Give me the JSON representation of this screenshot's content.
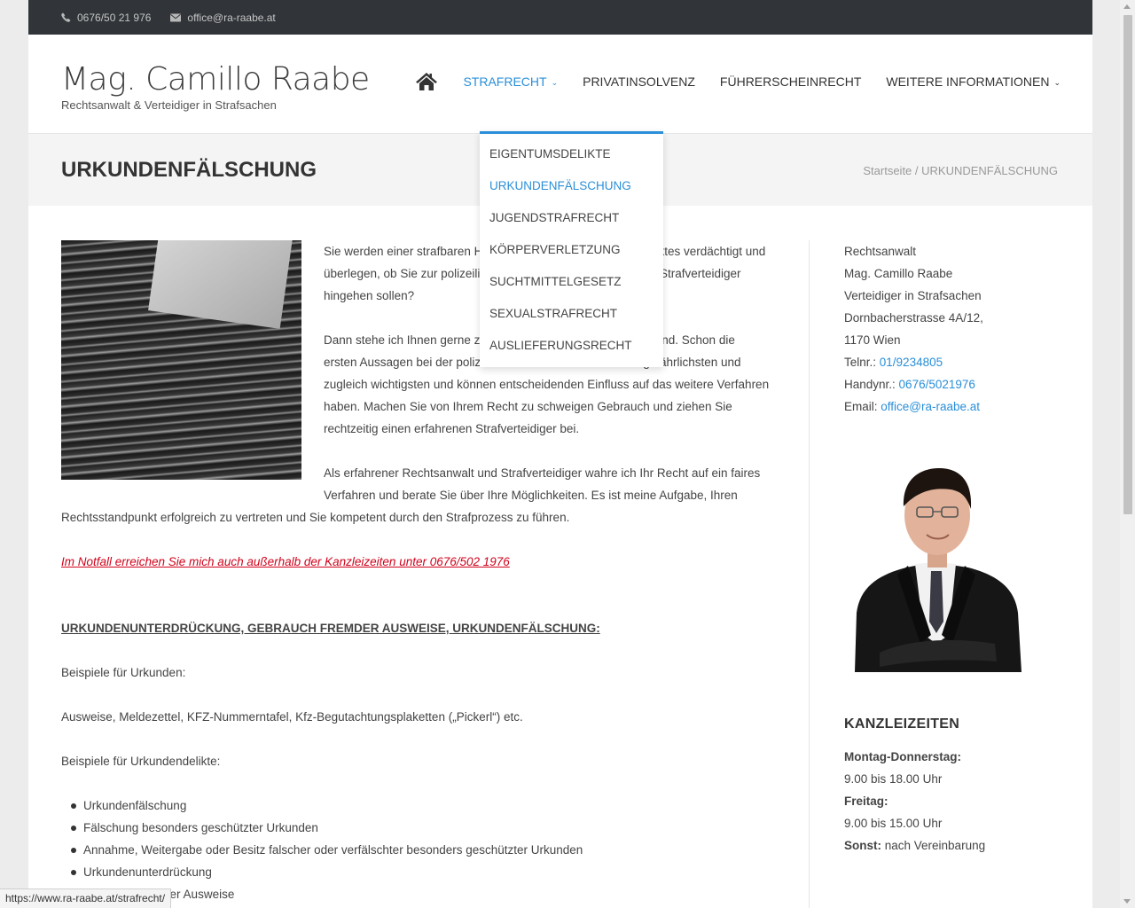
{
  "colors": {
    "accent": "#2a8fd8",
    "topbar": "#313539",
    "notfall": "#d0021b"
  },
  "topbar": {
    "phone_icon": "phone-icon",
    "phone": "0676/50 21 976",
    "email_icon": "envelope-icon",
    "email": "office@ra-raabe.at"
  },
  "header": {
    "title": "Mag. Camillo Raabe",
    "subtitle": "Rechtsanwalt & Verteidiger in Strafsachen"
  },
  "nav": {
    "home_icon": "home-icon",
    "items": [
      {
        "label": "STRAFRECHT",
        "has_dropdown": true,
        "active": true
      },
      {
        "label": "PRIVATINSOLVENZ"
      },
      {
        "label": "FÜHRERSCHEINRECHT"
      },
      {
        "label": "WEITERE INFORMATIONEN",
        "has_dropdown": true
      }
    ]
  },
  "dropdown": {
    "items": [
      {
        "label": "EIGENTUMSDELIKTE"
      },
      {
        "label": "URKUNDENFÄLSCHUNG",
        "active": true
      },
      {
        "label": "JUGENDSTRAFRECHT"
      },
      {
        "label": "KÖRPERVERLETZUNG"
      },
      {
        "label": "SUCHTMITTELGESETZ"
      },
      {
        "label": "SEXUALSTRAFRECHT"
      },
      {
        "label": "AUSLIEFERUNGSRECHT"
      }
    ]
  },
  "titlebar": {
    "title": "URKUNDENFÄLSCHUNG",
    "breadcrumb_home": "Startseite",
    "breadcrumb_sep": " / ",
    "breadcrumb_current": "URKUNDENFÄLSCHUNG"
  },
  "content": {
    "p1": "Sie werden einer strafbaren Handlung oder eines Urkundendeliktes verdächtigt und überlegen, ob Sie zur polizeilichen Einvernahme mit oder ohne Strafverteidiger hingehen sollen?",
    "p2": "Dann stehe ich Ihnen gerne zur Verfügung, auch wenn unpassend. Schon die ersten Aussagen bei der polizeilichen Einvernahme sind die gefährlichsten und zugleich wichtigsten und können entscheidenden Einfluss auf das weitere Verfahren haben. Machen Sie von Ihrem Recht zu schweigen Gebrauch und ziehen Sie rechtzeitig einen erfahrenen Strafverteidiger bei.",
    "p3": "Als erfahrener Rechtsanwalt und Strafverteidiger wahre ich Ihr Recht auf ein faires Verfahren und berate Sie über Ihre Möglichkeiten. Es ist meine Aufgabe, Ihren Rechtsstandpunkt erfolgreich zu vertreten und Sie kompetent durch den Strafprozess zu führen.",
    "notfall": "Im Notfall erreichen Sie mich auch außerhalb der Kanzleizeiten unter 0676/502 1976",
    "heading": "URKUNDENUNTERDRÜCKUNG, GEBRAUCH FREMDER AUSWEISE, URKUNDENFÄLSCHUNG:",
    "examples_label": "Beispiele für Urkunden:",
    "examples": "Ausweise, Meldezettel, KFZ-Nummerntafel, Kfz-Begutachtungsplaketten („Pickerl“) etc.",
    "delikte_label": "Beispiele für Urkundendelikte:",
    "delikte": [
      "Urkundenfälschung",
      "Fälschung besonders geschützter Urkunden",
      "Annahme, Weitergabe oder Besitz falscher oder verfälschter besonders geschützter Urkunden",
      "Urkundenunterdrückung",
      "Gebrauch fremder Ausweise"
    ]
  },
  "sidebar": {
    "line1": "Rechtsanwalt",
    "line2": "Mag. Camillo Raabe",
    "line3": "Verteidiger in Strafsachen",
    "line4": "Dornbacherstrasse 4A/12,",
    "line5": "1170 Wien",
    "tel_label": "Telnr.: ",
    "tel": "01/9234805",
    "handy_label": "Handynr.: ",
    "handy": "0676/5021976",
    "email_label": "Email: ",
    "email": "office@ra-raabe.at",
    "hours_title": "KANZLEIZEITEN",
    "mo_do_label": "Montag-Donnerstag:",
    "mo_do": "9.00 bis 18.00 Uhr",
    "fr_label": "Freitag:",
    "fr": "9.00 bis 15.00 Uhr",
    "sonst_label": "Sonst:",
    "sonst": " nach Vereinbarung"
  },
  "status": {
    "url": "https://www.ra-raabe.at/strafrecht/"
  }
}
